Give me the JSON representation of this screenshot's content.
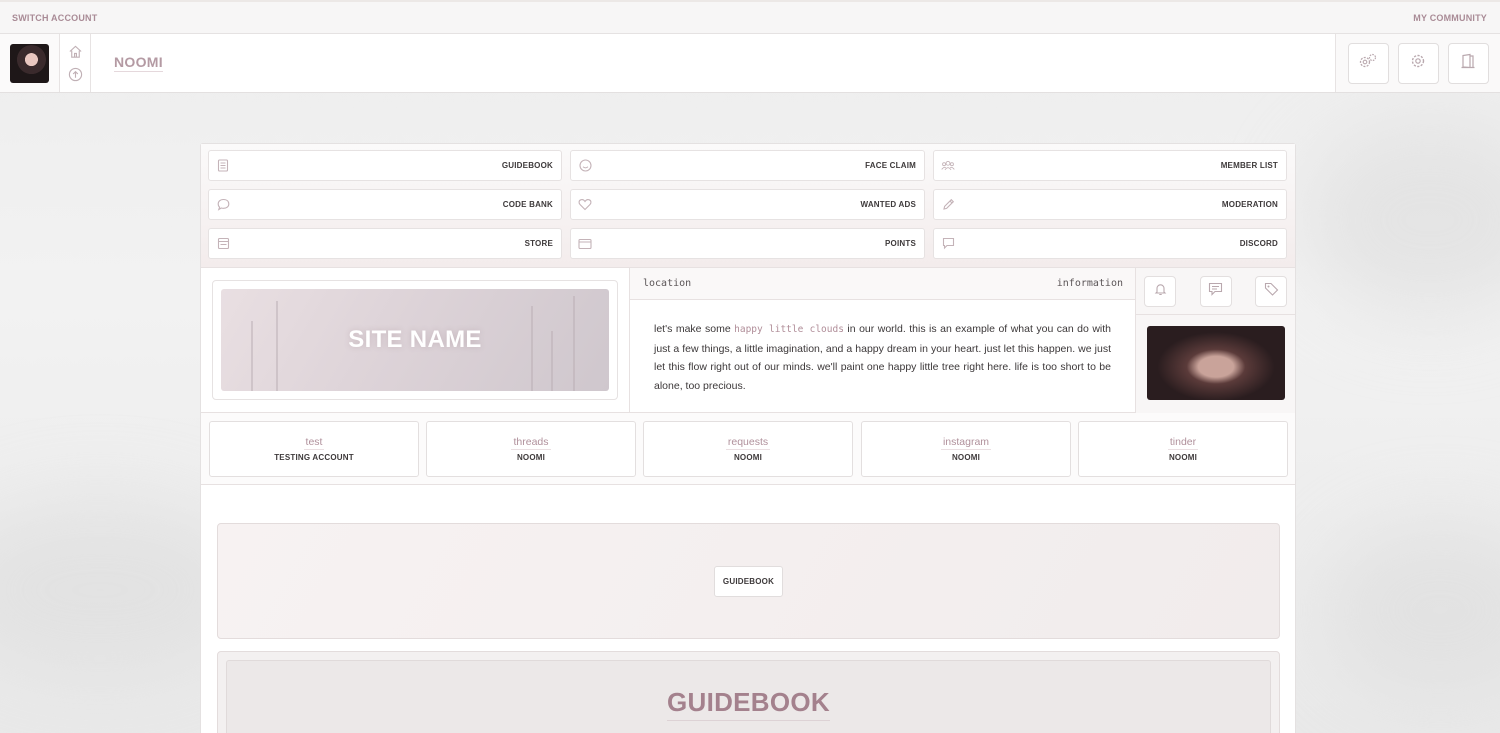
{
  "topbar": {
    "left_link": "SWITCH ACCOUNT",
    "right_link": "MY COMMUNITY"
  },
  "header": {
    "username": "NOOMI",
    "mini_icons": [
      "home-icon",
      "arrow-up-icon"
    ],
    "action_icons": [
      "gears-icon",
      "gear-icon",
      "door-icon"
    ]
  },
  "nav": {
    "items": [
      {
        "label": "GUIDEBOOK",
        "icon": "book-icon"
      },
      {
        "label": "FACE CLAIM",
        "icon": "smiley-icon"
      },
      {
        "label": "MEMBER LIST",
        "icon": "users-icon"
      },
      {
        "label": "CODE BANK",
        "icon": "chat-bubble-icon"
      },
      {
        "label": "WANTED ADS",
        "icon": "heart-icon"
      },
      {
        "label": "MODERATION",
        "icon": "pencil-icon"
      },
      {
        "label": "STORE",
        "icon": "store-icon"
      },
      {
        "label": "POINTS",
        "icon": "wallet-icon"
      },
      {
        "label": "DISCORD",
        "icon": "message-icon"
      }
    ]
  },
  "info": {
    "banner_title": "SITE NAME",
    "head_left": "location",
    "head_right": "information",
    "text_before": "let's make some ",
    "text_highlight": "happy little clouds",
    "text_after": " in our world. this is an example of what you can do with just a few things, a little imagination, and a happy dream in your heart. just let this happen. we just let this flow right out of our minds. we'll paint one happy little tree right here. life is too short to be alone, too precious.",
    "icons": [
      "bell-icon",
      "speech-bubble-icon",
      "tag-icon"
    ]
  },
  "cards": [
    {
      "title": "test",
      "sub": "TESTING ACCOUNT"
    },
    {
      "title": "threads",
      "sub": "NOOMI"
    },
    {
      "title": "requests",
      "sub": "NOOMI"
    },
    {
      "title": "instagram",
      "sub": "NOOMI"
    },
    {
      "title": "tinder",
      "sub": "NOOMI"
    }
  ],
  "guide": {
    "button_label": "GUIDEBOOK",
    "heading": "GUIDEBOOK"
  },
  "colors": {
    "accent": "#b49aa3",
    "accent_dark": "#a4818d",
    "text": "#3e3a3b",
    "border": "#e3dfdf"
  }
}
